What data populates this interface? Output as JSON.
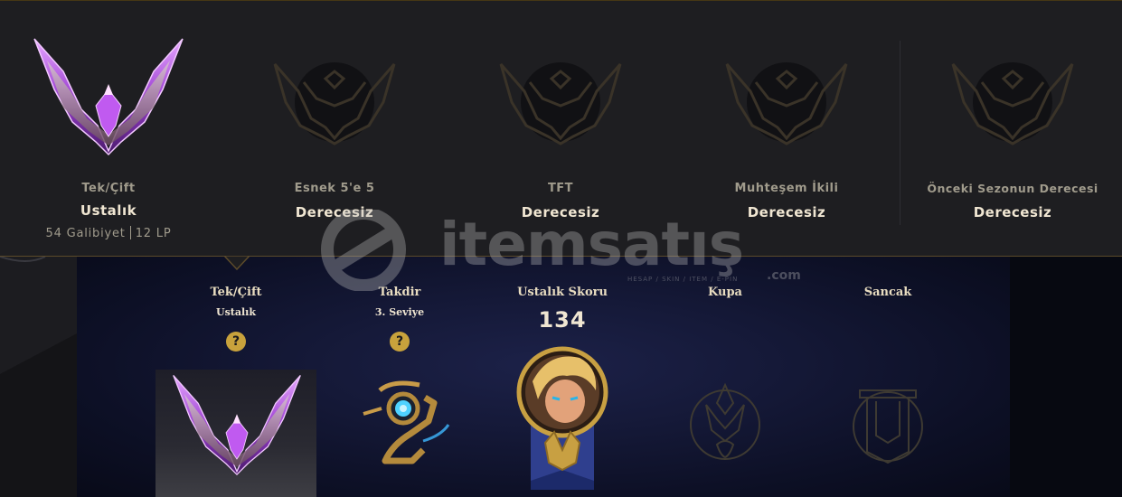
{
  "ranked": {
    "queues": [
      {
        "name": "Tek/Çift",
        "tier": "Ustalık",
        "wins": "54 Galibiyet",
        "lp": "12 LP"
      },
      {
        "name": "Esnek 5'e 5",
        "tier": "Derecesiz"
      },
      {
        "name": "TFT",
        "tier": "Derecesiz"
      },
      {
        "name": "Muhteşem İkili",
        "tier": "Derecesiz"
      },
      {
        "name": "Önceki Sezonun Derecesi",
        "tier": "Derecesiz"
      }
    ]
  },
  "profile": {
    "rank": {
      "title": "Tek/Çift",
      "value": "Ustalık"
    },
    "honor": {
      "title": "Takdir",
      "value": "3. Seviye"
    },
    "mastery": {
      "title": "Ustalık Skoru",
      "score": "134"
    },
    "trophy": {
      "title": "Kupa"
    },
    "banner": {
      "title": "Sancak"
    },
    "help_symbol": "?"
  },
  "watermark": {
    "brand": "itemsatış",
    "tagline": "HESAP / SKIN / ITEM / E-PIN",
    "domain": ".com"
  },
  "colors": {
    "panel_bg": "#1e1e21",
    "gold": "#c8a23c",
    "text_light": "#f0e6d2",
    "text_muted": "#a09b8c",
    "master_purple": "#b35ce0"
  }
}
